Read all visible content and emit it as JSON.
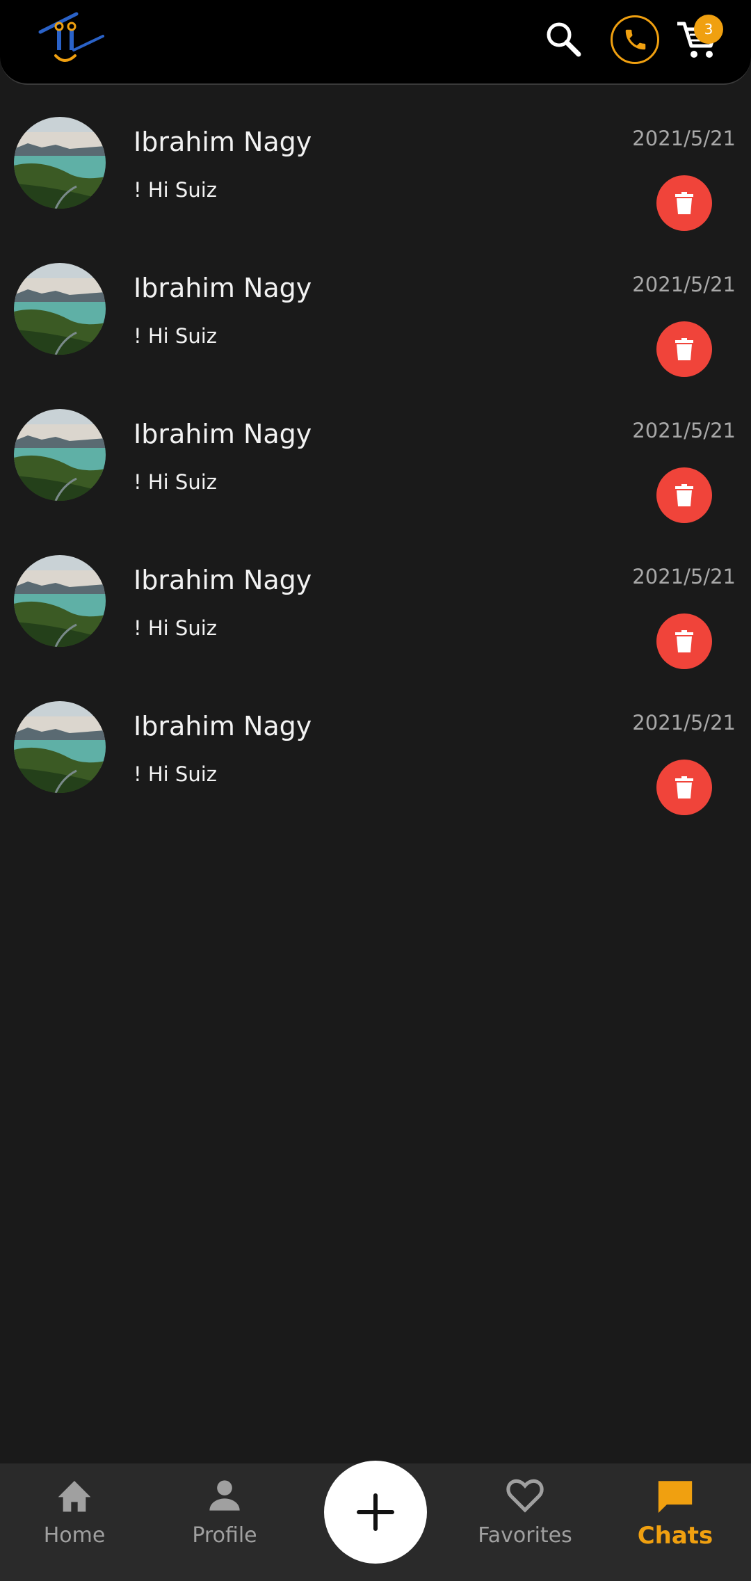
{
  "header": {
    "logo_icon": "app-logo",
    "search_icon": "search-icon",
    "phone_icon": "phone-icon",
    "cart_icon": "cart-icon",
    "cart_count": "3",
    "accent_color": "#f0a010"
  },
  "chats": [
    {
      "name": "Ibrahim Nagy",
      "message": "! Hi Suiz",
      "date": "2021/5/21"
    },
    {
      "name": "Ibrahim Nagy",
      "message": "! Hi Suiz",
      "date": "2021/5/21"
    },
    {
      "name": "Ibrahim Nagy",
      "message": "! Hi Suiz",
      "date": "2021/5/21"
    },
    {
      "name": "Ibrahim Nagy",
      "message": "! Hi Suiz",
      "date": "2021/5/21"
    },
    {
      "name": "Ibrahim Nagy",
      "message": "! Hi Suiz",
      "date": "2021/5/21"
    }
  ],
  "nav": {
    "home": "Home",
    "profile": "Profile",
    "favorites": "Favorites",
    "chats": "Chats",
    "active": "chats",
    "fab_icon": "plus-icon"
  },
  "colors": {
    "background": "#1a1a1a",
    "delete": "#f0443a",
    "active": "#f0a010"
  }
}
